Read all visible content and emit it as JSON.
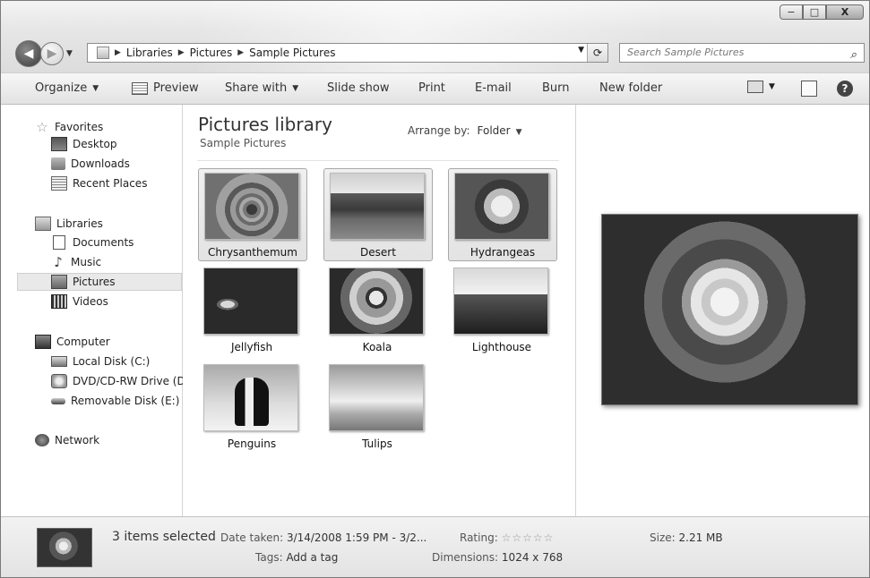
{
  "window_controls": {
    "minimize": "−",
    "maximize": "□",
    "close": "X"
  },
  "nav": {
    "back_glyph": "◀",
    "forward_glyph": "▶",
    "breadcrumbs": [
      "Libraries",
      "Pictures",
      "Sample Pictures"
    ],
    "breadcrumb_separator": "▶",
    "refresh_glyph": "⁺⁄₊",
    "search_placeholder": "Search Sample Pictures",
    "search_glyph": "⌕"
  },
  "toolbar": {
    "organize": "Organize",
    "preview": "Preview",
    "share_with": "Share with",
    "slide_show": "Slide show",
    "print": "Print",
    "email": "E-mail",
    "burn": "Burn",
    "new_folder": "New folder",
    "help_glyph": "?"
  },
  "sidebar": {
    "favorites": {
      "label": "Favorites",
      "items": [
        "Desktop",
        "Downloads",
        "Recent Places"
      ]
    },
    "libraries": {
      "label": "Libraries",
      "items": [
        "Documents",
        "Music",
        "Pictures",
        "Videos"
      ]
    },
    "computer": {
      "label": "Computer",
      "items": [
        "Local Disk (C:)",
        "DVD/CD-RW Drive (D",
        "Removable Disk (E:)"
      ]
    },
    "network": {
      "label": "Network"
    }
  },
  "library": {
    "title": "Pictures library",
    "subtitle": "Sample Pictures",
    "arrange_label": "Arrange by:",
    "arrange_value": "Folder"
  },
  "files": [
    {
      "name": "Chrysanthemum",
      "selected": true,
      "icon": "chrysanthemum-thumbnail"
    },
    {
      "name": "Desert",
      "selected": true,
      "icon": "desert-thumbnail"
    },
    {
      "name": "Hydrangeas",
      "selected": true,
      "icon": "hydrangeas-thumbnail"
    },
    {
      "name": "Jellyfish",
      "selected": false,
      "icon": "jellyfish-thumbnail"
    },
    {
      "name": "Koala",
      "selected": false,
      "icon": "koala-thumbnail"
    },
    {
      "name": "Lighthouse",
      "selected": false,
      "icon": "lighthouse-thumbnail"
    },
    {
      "name": "Penguins",
      "selected": false,
      "icon": "penguins-thumbnail"
    },
    {
      "name": "Tulips",
      "selected": false,
      "icon": "tulips-thumbnail"
    }
  ],
  "details": {
    "selection": "3 items selected",
    "date_taken_label": "Date taken:",
    "date_taken_value": "3/14/2008 1:59 PM - 3/2...",
    "tags_label": "Tags:",
    "tags_value": "Add a tag",
    "rating_label": "Rating:",
    "rating_stars": "☆☆☆☆☆",
    "dimensions_label": "Dimensions:",
    "dimensions_value": "1024 x 768",
    "size_label": "Size:",
    "size_value": "2.21 MB"
  }
}
